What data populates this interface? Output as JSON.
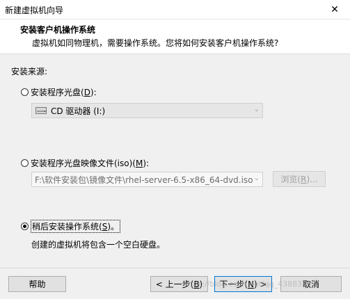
{
  "window": {
    "title": "新建虚拟机向导",
    "close_glyph": "✕"
  },
  "header": {
    "title": "安装客户机操作系统",
    "subtitle": "虚拟机如同物理机，需要操作系统。您将如何安装客户机操作系统?"
  },
  "install_source": {
    "label": "安装来源:",
    "option_disc": {
      "label_prefix": "安装程序光盘(",
      "accel": "D",
      "label_suffix": "):",
      "selected": false
    },
    "disc_drive": {
      "value": "CD 驱动器 (I:)",
      "icon": "cd-drive-icon"
    },
    "option_iso": {
      "label_prefix": "安装程序光盘映像文件(iso)(",
      "accel": "M",
      "label_suffix": "):",
      "selected": false
    },
    "iso_path": {
      "value": "F:\\软件安装包\\镜像文件\\rhel-server-6.5-x86_64-dvd.iso"
    },
    "browse_button": {
      "label_prefix": "浏览(",
      "accel": "R",
      "label_suffix": ")..."
    },
    "option_later": {
      "label_prefix": "稍后安装操作系统(",
      "accel": "S",
      "label_suffix": ")。",
      "selected": true
    },
    "later_note": "创建的虚拟机将包含一个空白硬盘。"
  },
  "footer": {
    "help": "帮助",
    "back": {
      "label_prefix": "< 上一步(",
      "accel": "B",
      "label_suffix": ")"
    },
    "next": {
      "label_prefix": "下一步(",
      "accel": "N",
      "label_suffix": ") >"
    },
    "cancel": "取消",
    "watermark": "https://blog.csdn.net/qq_43883885"
  },
  "colors": {
    "dialog_bg": "#f0f0f0",
    "header_bg": "#ffffff",
    "disabled_text": "#a0a0a0"
  }
}
